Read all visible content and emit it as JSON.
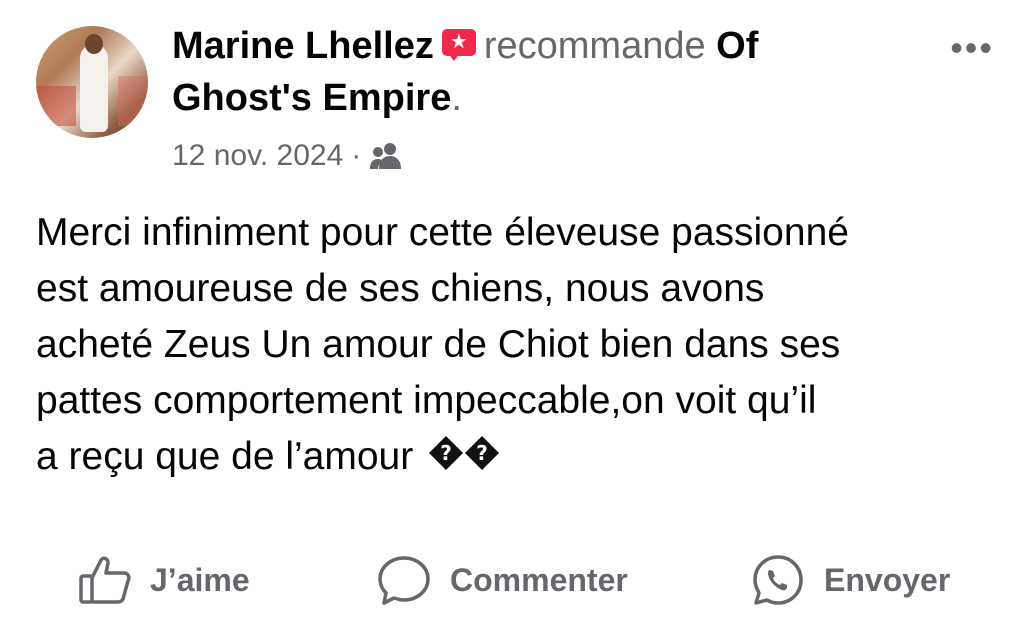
{
  "post": {
    "author": "Marine Lhellez",
    "action_text": "recommande",
    "page_name_line1": "Of",
    "page_name_line2": "Ghost's Empire",
    "period": ".",
    "date": "12 nov. 2024",
    "separator": "·",
    "audience_icon": "friends-icon",
    "recommend_badge_icon": "recommend-star-icon",
    "more_label": "•••",
    "text_lines": [
      "Merci infiniment pour cette éleveuse passionné",
      "est amoureuse de ses chiens, nous avons",
      "acheté Zeus Un amour de Chiot bien dans ses",
      "pattes comportement impeccable,on voit qu’il",
      "a reçu que de l’amour"
    ],
    "emoji_glyphs": [
      "�",
      "�"
    ]
  },
  "actions": {
    "like_label": "J’aime",
    "comment_label": "Commenter",
    "send_label": "Envoyer"
  },
  "colors": {
    "primary_text": "#050505",
    "secondary_text": "#65676b",
    "recommend_badge": "#f02849",
    "background": "#ffffff"
  }
}
